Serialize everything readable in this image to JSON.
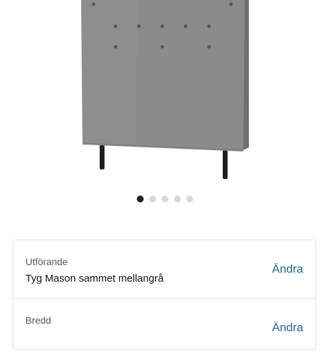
{
  "carousel": {
    "total": 5,
    "active": 1
  },
  "options": [
    {
      "label": "Utförande",
      "value": "Tyg Mason sammet mellangrå",
      "action": "Ändra"
    },
    {
      "label": "Bredd",
      "value": "",
      "action": "Ändra"
    }
  ],
  "colors": {
    "link": "#1b66a8",
    "fabric": "#8a8a8a"
  }
}
